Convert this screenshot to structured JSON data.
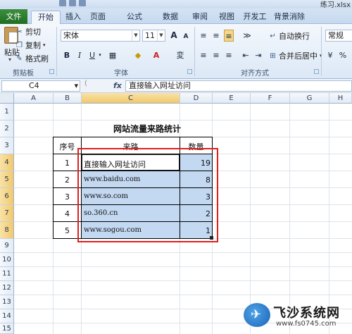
{
  "titlebar": {
    "filename": "练习.xlsx"
  },
  "tabs": [
    "文件",
    "开始",
    "插入",
    "页面布局",
    "公式",
    "数据",
    "审阅",
    "视图",
    "开发工具",
    "背景消除"
  ],
  "active_tab": "开始",
  "ribbon": {
    "paste": "粘贴",
    "cut": "剪切",
    "copy": "复制",
    "format_painter": "格式刷",
    "font_name": "宋体",
    "font_size": "11",
    "bold": "B",
    "italic": "I",
    "underline": "U",
    "grow_font": "A",
    "shrink_font": "A",
    "wrap_text": "自动换行",
    "merge_center": "合并后居中",
    "number_format": "常规",
    "groups": {
      "clipboard": "剪贴板",
      "font": "字体",
      "alignment": "对齐方式"
    }
  },
  "formula_bar": {
    "name_box": "C4",
    "fx": "fx",
    "formula": "直接输入网址访问"
  },
  "columns": [
    "A",
    "B",
    "C",
    "D",
    "E",
    "F",
    "G",
    "H"
  ],
  "selected_column": "C",
  "rows": [
    "1",
    "2",
    "3",
    "4",
    "5",
    "6",
    "7",
    "8",
    "9",
    "10",
    "11",
    "12",
    "13",
    "14",
    "15"
  ],
  "selected_rows": [
    "4",
    "5",
    "6",
    "7",
    "8"
  ],
  "sheet": {
    "title": "网站流量来路统计",
    "headers": {
      "index": "序号",
      "source": "来路",
      "count": "数量"
    },
    "records": [
      {
        "index": "1",
        "source": "直接输入网址访问",
        "count": "19"
      },
      {
        "index": "2",
        "source": "www.baidu.com",
        "count": "8"
      },
      {
        "index": "3",
        "source": "www.so.com",
        "count": "3"
      },
      {
        "index": "4",
        "source": "so.360.cn",
        "count": "2"
      },
      {
        "index": "5",
        "source": "www.sogou.com",
        "count": "1"
      }
    ]
  },
  "watermark": {
    "title": "飞沙系统网",
    "url": "www.fs0745.com"
  }
}
